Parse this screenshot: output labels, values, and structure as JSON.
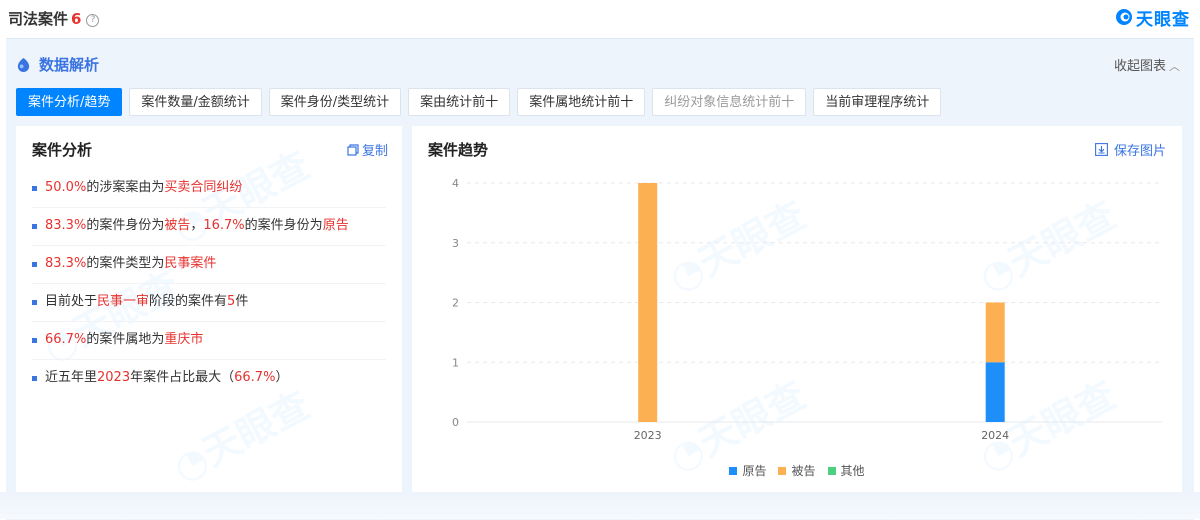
{
  "header": {
    "title": "司法案件",
    "count": "6",
    "help_icon": "question-circle-icon",
    "brand": "天眼查"
  },
  "panel": {
    "title": "数据解析",
    "collapse_label": "收起图表",
    "tabs": [
      {
        "label": "案件分析/趋势",
        "active": true
      },
      {
        "label": "案件数量/金额统计"
      },
      {
        "label": "案件身份/类型统计"
      },
      {
        "label": "案由统计前十"
      },
      {
        "label": "案件属地统计前十"
      },
      {
        "label": "纠纷对象信息统计前十",
        "disabled": true
      },
      {
        "label": "当前审理程序统计"
      }
    ]
  },
  "analysis": {
    "title": "案件分析",
    "copy_label": "复制",
    "items": [
      [
        {
          "t": "50.0%",
          "hl": true
        },
        {
          "t": "的涉案案由为"
        },
        {
          "t": "买卖合同纠纷",
          "hl": true
        }
      ],
      [
        {
          "t": "83.3%",
          "hl": true
        },
        {
          "t": "的案件身份为"
        },
        {
          "t": "被告",
          "hl": true
        },
        {
          "t": "，"
        },
        {
          "t": "16.7%",
          "hl": true
        },
        {
          "t": "的案件身份为"
        },
        {
          "t": "原告",
          "hl": true
        }
      ],
      [
        {
          "t": "83.3%",
          "hl": true
        },
        {
          "t": "的案件类型为"
        },
        {
          "t": "民事案件",
          "hl": true
        }
      ],
      [
        {
          "t": "目前处于"
        },
        {
          "t": "民事一审",
          "hl": true
        },
        {
          "t": "阶段的案件有"
        },
        {
          "t": "5",
          "hl": true
        },
        {
          "t": "件"
        }
      ],
      [
        {
          "t": "66.7%",
          "hl": true
        },
        {
          "t": "的案件属地为"
        },
        {
          "t": "重庆市",
          "hl": true
        }
      ],
      [
        {
          "t": "近五年里"
        },
        {
          "t": "2023",
          "hl": true
        },
        {
          "t": "年案件占比最大（"
        },
        {
          "t": "66.7%",
          "hl": true
        },
        {
          "t": "）"
        }
      ]
    ]
  },
  "trend": {
    "title": "案件趋势",
    "save_label": "保存图片"
  },
  "chart_data": {
    "type": "bar",
    "stacked": true,
    "categories": [
      "2023",
      "2024"
    ],
    "series": [
      {
        "name": "原告",
        "values": [
          0,
          1
        ],
        "color": "#1e8ff8"
      },
      {
        "name": "被告",
        "values": [
          4,
          1
        ],
        "color": "#fdb052"
      },
      {
        "name": "其他",
        "values": [
          0,
          0
        ],
        "color": "#4ccf7e"
      }
    ],
    "yticks": [
      0,
      1,
      2,
      3,
      4
    ],
    "ylim": [
      0,
      4
    ],
    "grid": true,
    "legend_position": "bottom-center"
  },
  "colors": {
    "accent": "#0084ff",
    "highlight": "#e6322e",
    "panel_bg": "#eef4fc"
  }
}
